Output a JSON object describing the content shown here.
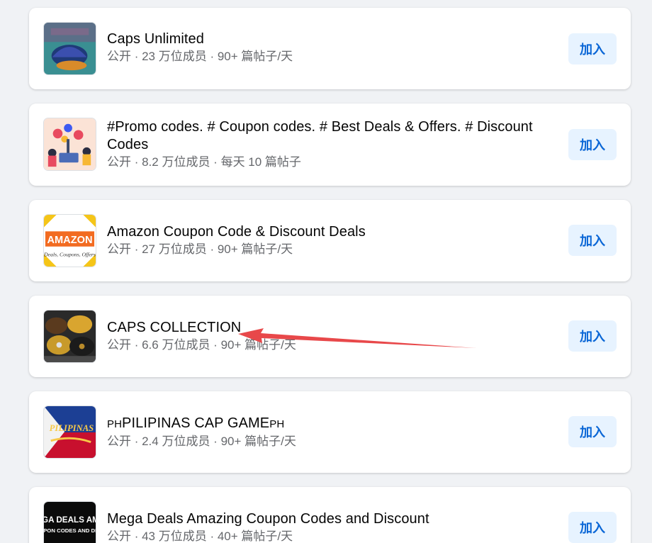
{
  "join_label": "加入",
  "groups": [
    {
      "name": "Caps Unlimited",
      "meta": "公开 · 23 万位成员 · 90+ 篇帖子/天"
    },
    {
      "name": "#Promo codes. # Coupon codes. # Best Deals & Offers. # Discount Codes",
      "meta": "公开 · 8.2 万位成员 · 每天 10 篇帖子"
    },
    {
      "name": "Amazon Coupon Code & Discount Deals",
      "meta": "公开 · 27 万位成员 · 90+ 篇帖子/天",
      "thumb_text": "AMAZON",
      "thumb_subtext": "Deals, Coupons, Offers"
    },
    {
      "name": "CAPS COLLECTION",
      "meta": "公开 · 6.6 万位成员 · 90+ 篇帖子/天"
    },
    {
      "name_prefix": "PH",
      "name_main": "PILIPINAS CAP GAME",
      "name_suffix": "PH",
      "meta": "公开 · 2.4 万位成员 · 90+ 篇帖子/天",
      "thumb_text": "PILIPINAS"
    },
    {
      "name": "Mega Deals Amazing Coupon Codes and Discount",
      "meta": "公开 · 43 万位成员 · 40+ 篇帖子/天",
      "thumb_text": "MEGA DEALS AMAZ",
      "thumb_subtext": "COUPON CODES AND DISCO"
    }
  ],
  "colors": {
    "background": "#f0f2f5",
    "join_bg": "#e7f3ff",
    "join_text": "#0a66d6",
    "annotation_arrow": "#e8484a"
  }
}
